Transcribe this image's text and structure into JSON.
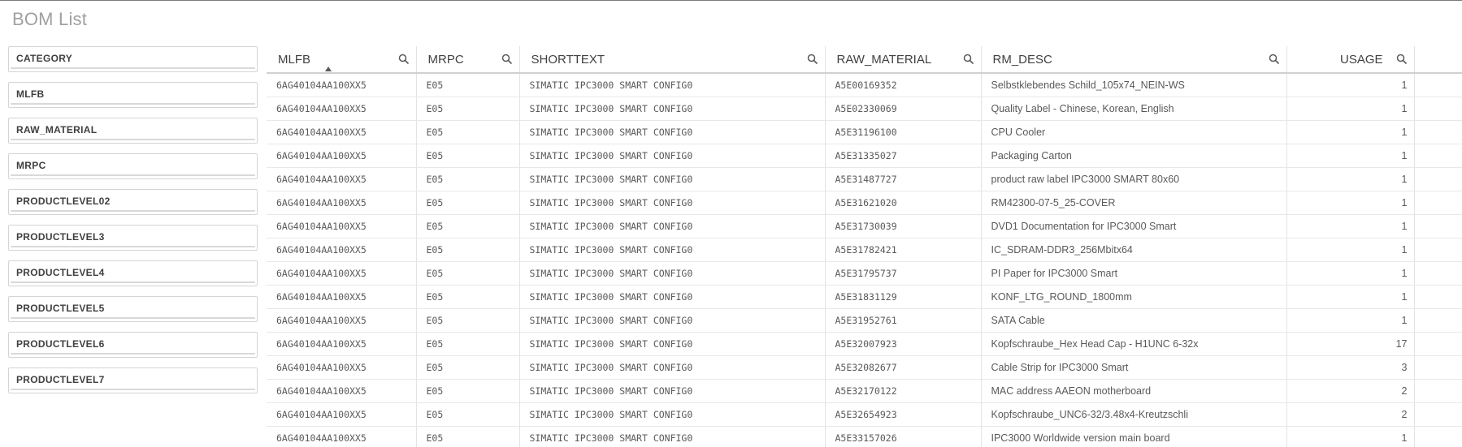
{
  "sheet": {
    "title": "BOM List"
  },
  "filters": [
    {
      "label": "CATEGORY"
    },
    {
      "label": "MLFB"
    },
    {
      "label": "RAW_MATERIAL"
    },
    {
      "label": "MRPC"
    },
    {
      "label": "PRODUCTLEVEL02"
    },
    {
      "label": "PRODUCTLEVEL3"
    },
    {
      "label": "PRODUCTLEVEL4"
    },
    {
      "label": "PRODUCTLEVEL5"
    },
    {
      "label": "PRODUCTLEVEL6"
    },
    {
      "label": "PRODUCTLEVEL7"
    }
  ],
  "table": {
    "columns": [
      {
        "label": "MLFB",
        "sorted": "ascending"
      },
      {
        "label": "MRPC"
      },
      {
        "label": "SHORTTEXT"
      },
      {
        "label": "RAW_MATERIAL"
      },
      {
        "label": "RM_DESC"
      },
      {
        "label": "USAGE"
      }
    ],
    "rows": [
      [
        "6AG40104AA100XX5",
        "E05",
        "SIMATIC IPC3000 SMART CONFIG0",
        "A5E00169352",
        "Selbstklebendes Schild_105x74_NEIN-WS",
        "1"
      ],
      [
        "6AG40104AA100XX5",
        "E05",
        "SIMATIC IPC3000 SMART CONFIG0",
        "A5E02330069",
        "Quality Label - Chinese, Korean, English",
        "1"
      ],
      [
        "6AG40104AA100XX5",
        "E05",
        "SIMATIC IPC3000 SMART CONFIG0",
        "A5E31196100",
        "CPU Cooler",
        "1"
      ],
      [
        "6AG40104AA100XX5",
        "E05",
        "SIMATIC IPC3000 SMART CONFIG0",
        "A5E31335027",
        "Packaging Carton",
        "1"
      ],
      [
        "6AG40104AA100XX5",
        "E05",
        "SIMATIC IPC3000 SMART CONFIG0",
        "A5E31487727",
        "product raw label IPC3000 SMART 80x60",
        "1"
      ],
      [
        "6AG40104AA100XX5",
        "E05",
        "SIMATIC IPC3000 SMART CONFIG0",
        "A5E31621020",
        "RM42300-07-5_25-COVER",
        "1"
      ],
      [
        "6AG40104AA100XX5",
        "E05",
        "SIMATIC IPC3000 SMART CONFIG0",
        "A5E31730039",
        "DVD1 Documentation for IPC3000 Smart",
        "1"
      ],
      [
        "6AG40104AA100XX5",
        "E05",
        "SIMATIC IPC3000 SMART CONFIG0",
        "A5E31782421",
        "IC_SDRAM-DDR3_256Mbitx64",
        "1"
      ],
      [
        "6AG40104AA100XX5",
        "E05",
        "SIMATIC IPC3000 SMART CONFIG0",
        "A5E31795737",
        "PI Paper for IPC3000 Smart",
        "1"
      ],
      [
        "6AG40104AA100XX5",
        "E05",
        "SIMATIC IPC3000 SMART CONFIG0",
        "A5E31831129",
        "KONF_LTG_ROUND_1800mm",
        "1"
      ],
      [
        "6AG40104AA100XX5",
        "E05",
        "SIMATIC IPC3000 SMART CONFIG0",
        "A5E31952761",
        "SATA Cable",
        "1"
      ],
      [
        "6AG40104AA100XX5",
        "E05",
        "SIMATIC IPC3000 SMART CONFIG0",
        "A5E32007923",
        "Kopfschraube_Hex Head Cap - H1UNC 6-32x",
        "17"
      ],
      [
        "6AG40104AA100XX5",
        "E05",
        "SIMATIC IPC3000 SMART CONFIG0",
        "A5E32082677",
        "Cable Strip for IPC3000 Smart",
        "3"
      ],
      [
        "6AG40104AA100XX5",
        "E05",
        "SIMATIC IPC3000 SMART CONFIG0",
        "A5E32170122",
        "MAC address AAEON motherboard",
        "2"
      ],
      [
        "6AG40104AA100XX5",
        "E05",
        "SIMATIC IPC3000 SMART CONFIG0",
        "A5E32654923",
        "Kopfschraube_UNC6-32/3.48x4-Kreutzschli",
        "2"
      ],
      [
        "6AG40104AA100XX5",
        "E05",
        "SIMATIC IPC3000 SMART CONFIG0",
        "A5E33157026",
        "IPC3000 Worldwide version main board",
        "1"
      ]
    ]
  },
  "icons": {
    "column_search": "search-icon",
    "sort": "sort-ascending-icon"
  }
}
